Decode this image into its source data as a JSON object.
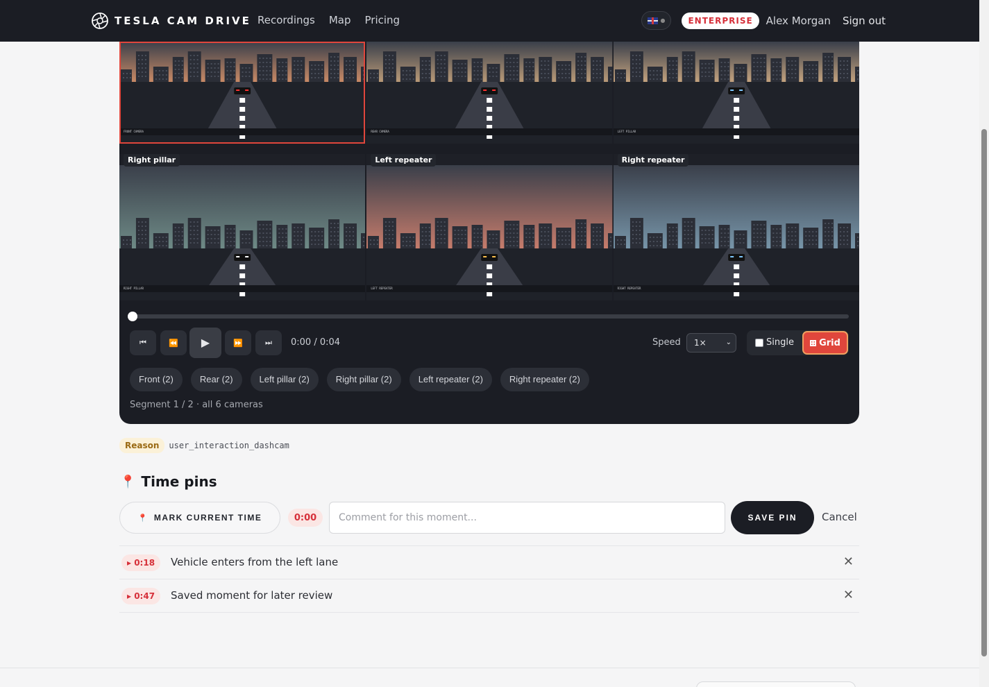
{
  "nav": {
    "brand": "TESLA CAM DRIVE",
    "links": [
      "Recordings",
      "Map",
      "Pricing"
    ],
    "plan_badge": "ENTERPRISE",
    "user": "Alex Morgan",
    "sign_out": "Sign out"
  },
  "cameras": [
    {
      "label": "",
      "caption": "FRONT CAMERA",
      "sky": "#c98a66",
      "active": true,
      "light": "#ff3030"
    },
    {
      "label": "",
      "caption": "REAR CAMERA",
      "sky": "#b99a78",
      "active": false,
      "light": "#ff3030"
    },
    {
      "label": "",
      "caption": "LEFT PILLAR",
      "sky": "#c4a37f",
      "active": false,
      "light": "#7ec8ff"
    },
    {
      "label": "Right pillar",
      "caption": "RIGHT PILLAR",
      "sky": "#6e8a86",
      "active": false,
      "light": "#ffffff"
    },
    {
      "label": "Left repeater",
      "caption": "LEFT REPEATER",
      "sky": "#c67c6c",
      "active": false,
      "light": "#ffc14d"
    },
    {
      "label": "Right repeater",
      "caption": "RIGHT REPEATER",
      "sky": "#7795a9",
      "active": false,
      "light": "#7ec8ff"
    }
  ],
  "playback": {
    "progress": 0,
    "time": "0:00 / 0:04",
    "speed_label": "Speed",
    "speed_value": "1×",
    "mode_single": "Single",
    "mode_grid": "Grid"
  },
  "camera_chips": [
    "Front (2)",
    "Rear (2)",
    "Left pillar (2)",
    "Right pillar (2)",
    "Left repeater (2)",
    "Right repeater (2)"
  ],
  "segment_info": "Segment 1 / 2 · all 6 cameras",
  "reason": {
    "tag": "Reason",
    "value": "user_interaction_dashcam"
  },
  "pins": {
    "title": "Time pins",
    "mark_label": "MARK CURRENT TIME",
    "current_time": "0:00",
    "comment_placeholder": "Comment for this moment...",
    "save_label": "SAVE PIN",
    "cancel_label": "Cancel",
    "items": [
      {
        "time": "▸ 0:18",
        "text": "Vehicle enters from the left lane"
      },
      {
        "time": "▸ 0:47",
        "text": "Saved moment for later review"
      }
    ]
  }
}
